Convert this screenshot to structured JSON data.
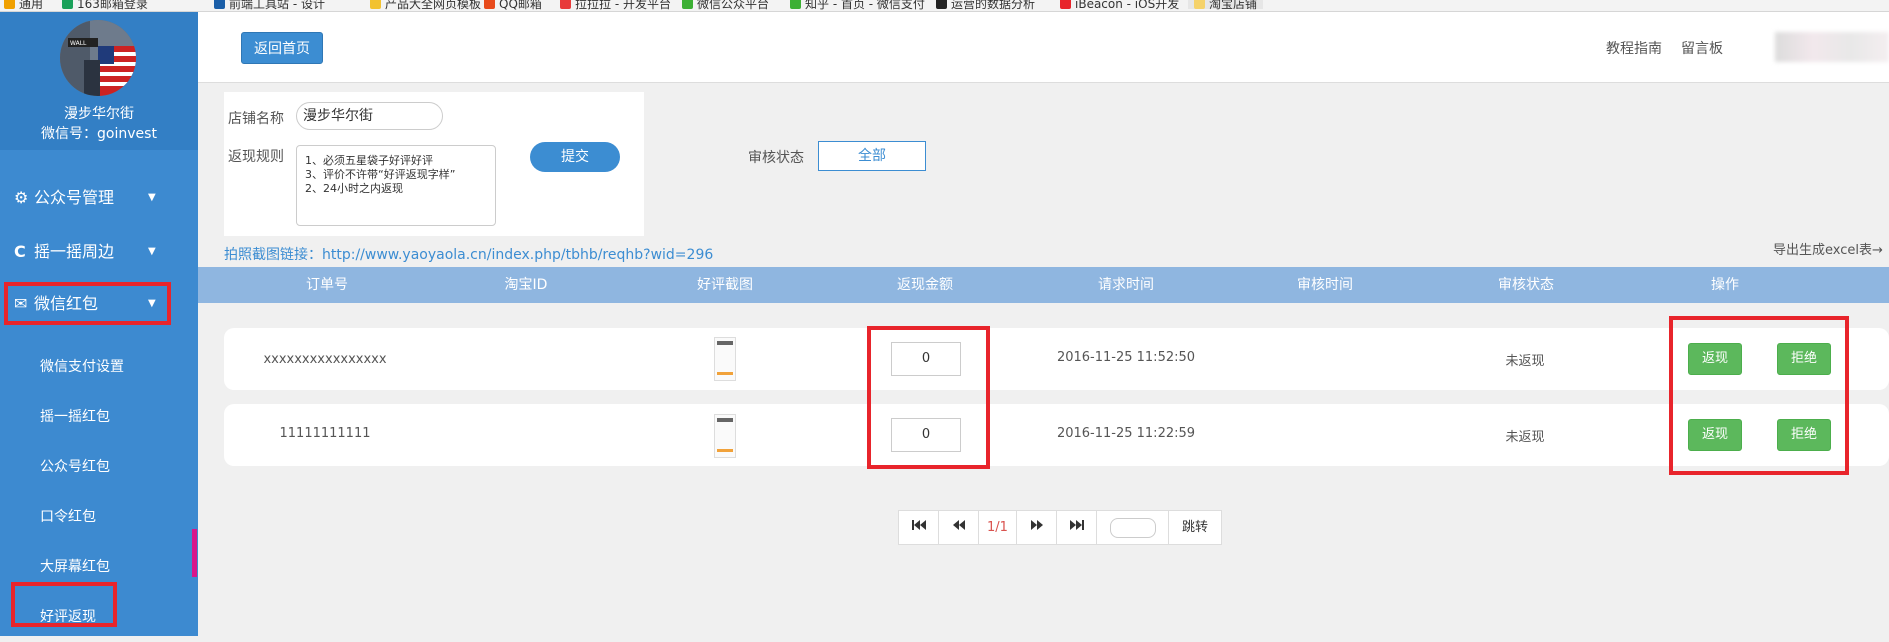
{
  "bookmarks": [
    "通用",
    "163邮箱登录",
    "前端工具站 - 设计",
    "产品大全网页模板",
    "QQ邮箱",
    "拉拉拉 - 开发平台",
    "微信公众平台",
    "知乎 - 首页 - 微信支付",
    "运营的数据分析",
    "iBeacon - iOS开发",
    "淘宝店铺"
  ],
  "sidebar": {
    "nickname": "漫步华尔街",
    "wechat_id": "微信号：goinvest",
    "menus": [
      {
        "label": "公众号管理",
        "icon": "gear-icon",
        "glyph": "⚙"
      },
      {
        "label": "摇一摇周边",
        "icon": "refresh-icon",
        "glyph": "C"
      },
      {
        "label": "微信红包",
        "icon": "envelope-icon",
        "glyph": "✉"
      }
    ],
    "submenu": [
      "微信支付设置",
      "摇一摇红包",
      "公众号红包",
      "口令红包",
      "大屏幕红包",
      "好评返现"
    ]
  },
  "header": {
    "home_button": "返回首页",
    "links": [
      "教程指南",
      "留言板"
    ]
  },
  "form": {
    "shop_label": "店铺名称",
    "shop_value": "漫步华尔街",
    "rules_label": "返现规则",
    "rules_value": "1、必须五星袋子好评好评\n3、评价不许带“好评返现字样”\n2、24小时之内返现",
    "submit": "提交",
    "status_label": "审核状态",
    "status_value": "全部",
    "link_text": "拍照截图链接：http://www.yaoyaola.cn/index.php/tbhb/reqhb?wid=296",
    "export": "导出生成excel表→"
  },
  "table": {
    "columns": [
      "订单号",
      "淘宝ID",
      "好评截图",
      "返现金额",
      "请求时间",
      "审核时间",
      "审核状态",
      "操作"
    ],
    "rows": [
      {
        "order": "xxxxxxxxxxxxxxxx",
        "taobao_id": "",
        "amount": "0",
        "request_time": "2016-11-25 11:52:50",
        "review_time": "",
        "status": "未返现",
        "approve": "返现",
        "reject": "拒绝"
      },
      {
        "order": "11111111111",
        "taobao_id": "",
        "amount": "0",
        "request_time": "2016-11-25 11:22:59",
        "review_time": "",
        "status": "未返现",
        "approve": "返现",
        "reject": "拒绝"
      }
    ]
  },
  "pagination": {
    "page": "1/1",
    "jump": "跳转",
    "first_icon": "first-page-icon",
    "prev_icon": "prev-page-icon",
    "next_icon": "next-page-icon",
    "last_icon": "last-page-icon"
  },
  "colors": {
    "primary": "#3c8dd2",
    "sidebar": "#3d8ad0",
    "table_header": "#8fb6e0",
    "green": "#5cb85c",
    "highlight": "#e8242b"
  }
}
